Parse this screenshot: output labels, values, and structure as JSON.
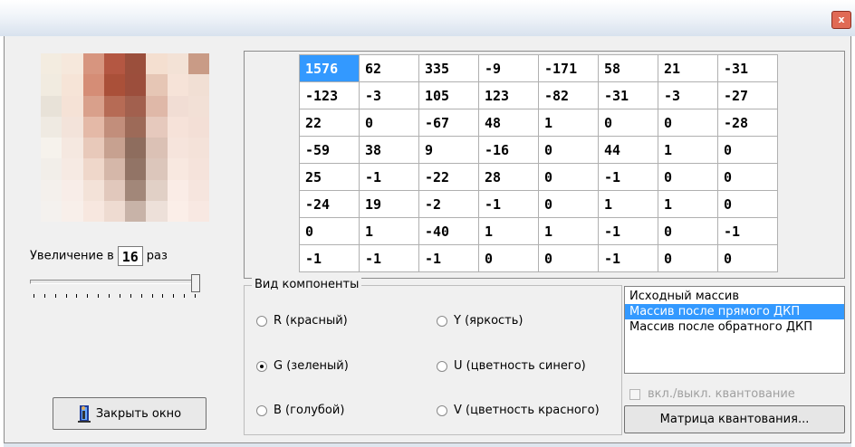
{
  "window": {
    "close_glyph": "x"
  },
  "preview": {
    "colors": [
      [
        "#f3ece0",
        "#f6e8dc",
        "#d7957f",
        "#b45742",
        "#9b4f3c",
        "#f4dfd0",
        "#f3e2d6",
        "#c99b86"
      ],
      [
        "#f1ebe0",
        "#f6e4d7",
        "#d58d76",
        "#aa5039",
        "#9c4e3c",
        "#e6c6b5",
        "#f6e3d8",
        "#f1dfd4"
      ],
      [
        "#e8e2d8",
        "#f5e2d6",
        "#d9a08b",
        "#b66b55",
        "#a2604e",
        "#dfb8a8",
        "#f1ddd4",
        "#f2e0d6"
      ],
      [
        "#efeae2",
        "#f3e3da",
        "#e4b9a7",
        "#c28e7b",
        "#9d6a58",
        "#e6c9bd",
        "#f6e2d9",
        "#f3dfd6"
      ],
      [
        "#f6f2ec",
        "#f5e8e0",
        "#e8c9ba",
        "#c7a190",
        "#8e6d5e",
        "#dbc1b5",
        "#f6e4dc",
        "#f4e2d9"
      ],
      [
        "#f2eee9",
        "#f6eae3",
        "#efd7ca",
        "#d5b7a9",
        "#927466",
        "#dcc6bb",
        "#f8e8e0",
        "#f5e3db"
      ],
      [
        "#f4f0ec",
        "#f8ede8",
        "#f3e2d8",
        "#e1c8bc",
        "#a28779",
        "#e1d0c6",
        "#faece6",
        "#f6e5de"
      ],
      [
        "#f4f1ee",
        "#f8efea",
        "#f7e7df",
        "#eedbd1",
        "#c8b3a8",
        "#ede0d9",
        "#fbeee8",
        "#f8e8e2"
      ]
    ]
  },
  "zoom": {
    "prefix": "Увеличение в",
    "value": "16",
    "suffix": "раз"
  },
  "slider": {
    "position_fraction": 1.0,
    "tick_count": 16
  },
  "buttons": {
    "close_window": "Закрыть окно",
    "quant_matrix": "Матрица квантования..."
  },
  "coefficients": {
    "selected": [
      0,
      0
    ],
    "rows": [
      [
        "1576",
        "62",
        "335",
        "-9",
        "-171",
        "58",
        "21",
        "-31"
      ],
      [
        "-123",
        "-3",
        "105",
        "123",
        "-82",
        "-31",
        "-3",
        "-27"
      ],
      [
        "22",
        "0",
        "-67",
        "48",
        "1",
        "0",
        "0",
        "-28"
      ],
      [
        "-59",
        "38",
        "9",
        "-16",
        "0",
        "44",
        "1",
        "0"
      ],
      [
        "25",
        "-1",
        "-22",
        "28",
        "0",
        "-1",
        "0",
        "0"
      ],
      [
        "-24",
        "19",
        "-2",
        "-1",
        "0",
        "1",
        "1",
        "0"
      ],
      [
        "0",
        "1",
        "-40",
        "1",
        "1",
        "-1",
        "0",
        "-1"
      ],
      [
        "-1",
        "-1",
        "-1",
        "0",
        "0",
        "-1",
        "0",
        "0"
      ]
    ]
  },
  "component": {
    "title": "Вид компоненты",
    "options": [
      {
        "label": "R (красный)",
        "checked": false
      },
      {
        "label": "G (зеленый)",
        "checked": true
      },
      {
        "label": "B (голубой)",
        "checked": false
      },
      {
        "label": "Y (яркость)",
        "checked": false
      },
      {
        "label": "U (цветность синего)",
        "checked": false
      },
      {
        "label": "V (цветность красного)",
        "checked": false
      }
    ]
  },
  "array_list": {
    "items": [
      "Исходный массив",
      "Массив после прямого ДКП",
      "Массив после обратного ДКП"
    ],
    "selected_index": 1
  },
  "quantization": {
    "label": "вкл./выкл. квантование",
    "checked": false,
    "enabled": false
  }
}
